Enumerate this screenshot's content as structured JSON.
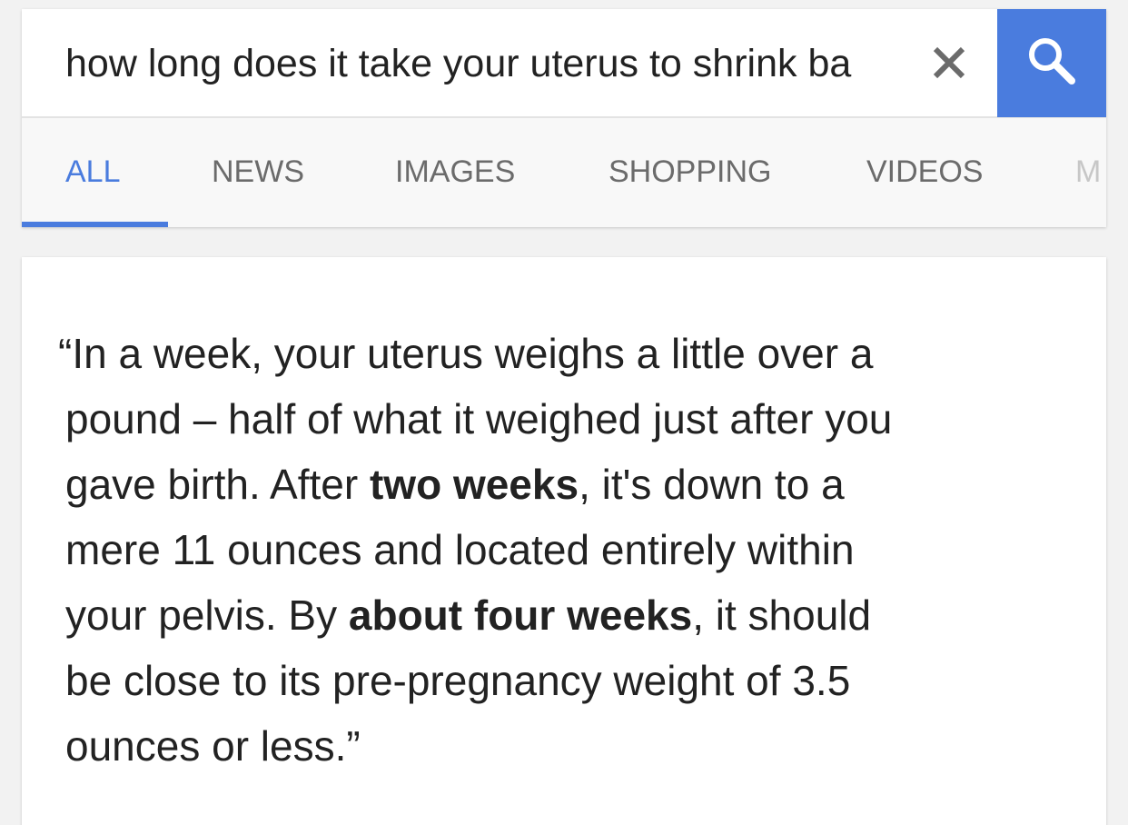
{
  "search": {
    "query": "how long does it take your uterus to shrink ba"
  },
  "icons": {
    "clear": "close-icon",
    "search": "search-icon"
  },
  "colors": {
    "accent": "#4a7cde",
    "tab_inactive": "#6b6b6b",
    "text": "#222222"
  },
  "tabs": [
    {
      "label": "ALL",
      "active": true
    },
    {
      "label": "NEWS",
      "active": false
    },
    {
      "label": "IMAGES",
      "active": false
    },
    {
      "label": "SHOPPING",
      "active": false
    },
    {
      "label": "VIDEOS",
      "active": false
    },
    {
      "label": "M",
      "active": false
    }
  ],
  "answer": {
    "line1": "“In a week, your uterus weighs a little over a",
    "line2": "pound – half of what it weighed just after you",
    "line3_pre": "gave birth. After ",
    "line3_bold": "two weeks",
    "line3_post": ", it's down to a",
    "line4": "mere 11 ounces and located entirely within",
    "line5_pre": "your pelvis. By ",
    "line5_bold": "about four weeks",
    "line5_post": ", it should",
    "line6": "be close to its pre-pregnancy weight of 3.5",
    "line7": "ounces or less.”"
  }
}
